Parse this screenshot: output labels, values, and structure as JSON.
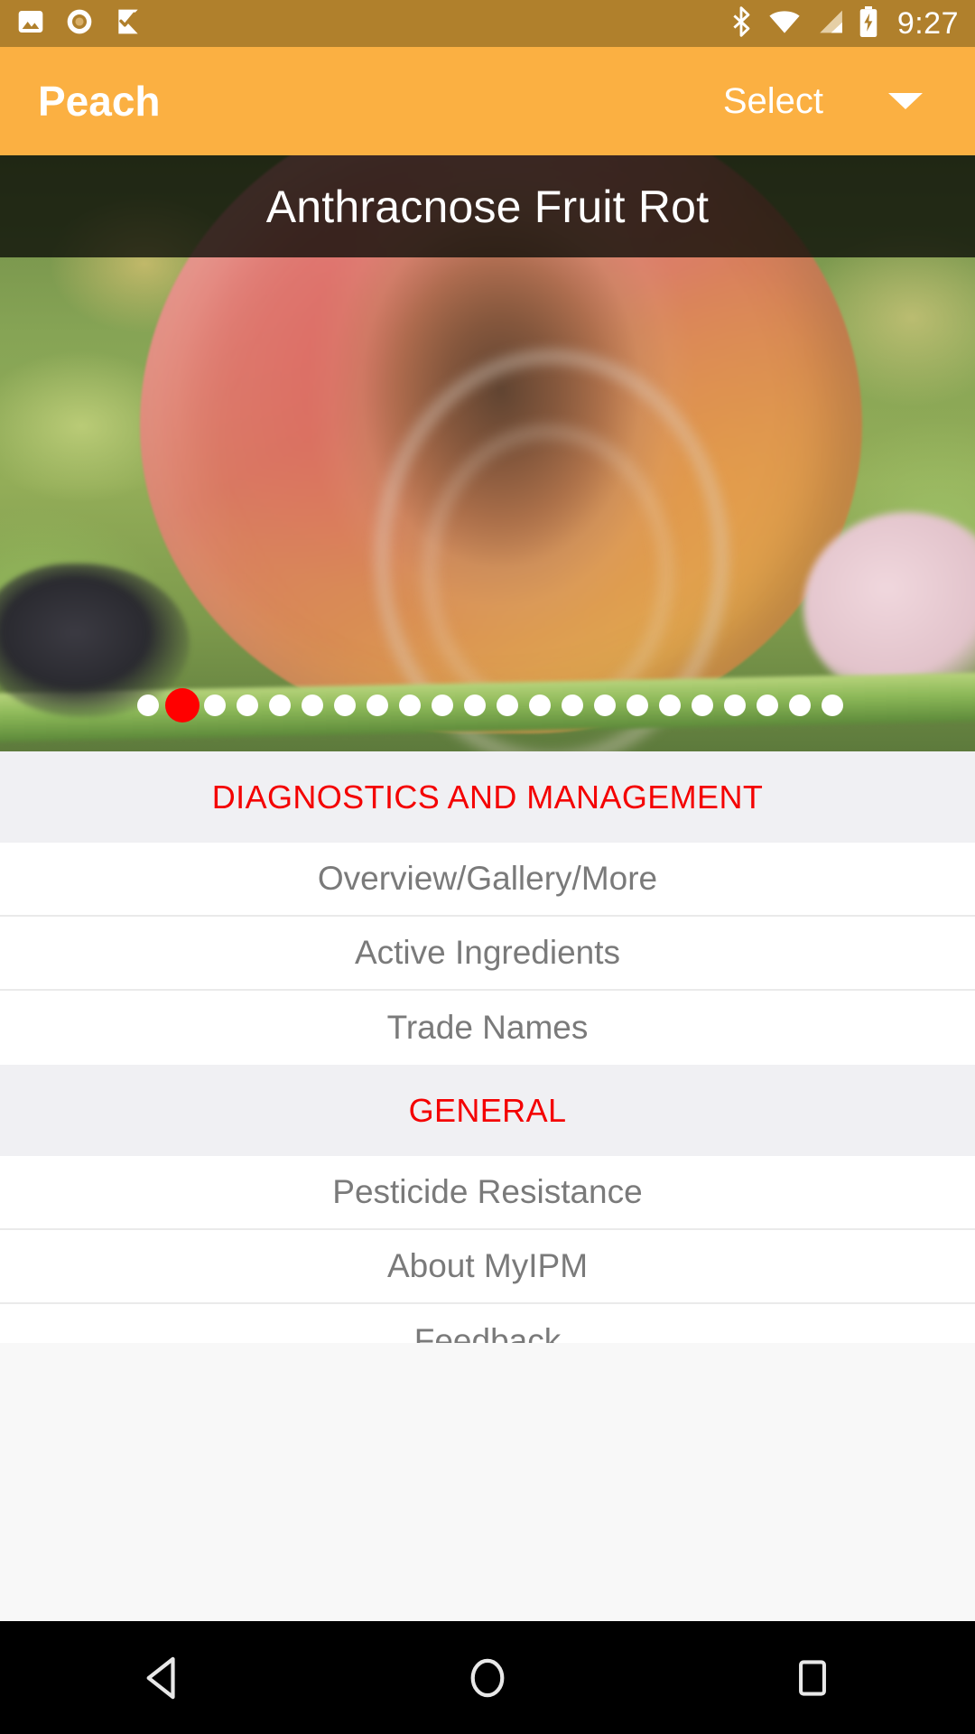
{
  "status_bar": {
    "background_color": "#b0802c",
    "clock": "9:27",
    "left_icons": [
      {
        "name": "image-icon",
        "glyph": "photo"
      },
      {
        "name": "record-disc-icon",
        "glyph": "disc"
      },
      {
        "name": "checkmark-flag-icon",
        "glyph": "flag-check"
      }
    ],
    "right_icons": [
      {
        "name": "bluetooth-icon"
      },
      {
        "name": "wifi-icon"
      },
      {
        "name": "cellular-signal-icon"
      },
      {
        "name": "battery-charging-icon"
      }
    ]
  },
  "app_bar": {
    "background_color": "#fbb042",
    "title": "Peach",
    "select_label": "Select",
    "caret": "▼"
  },
  "hero": {
    "disease_title": "Anthracnose Fruit Rot",
    "image_description": "Peach fruit with brown sunken anthracnose lesion with concentric rings",
    "carousel": {
      "total_dots": 22,
      "active_index": 1,
      "active_color": "#ff0000",
      "inactive_color": "#ffffff"
    }
  },
  "menu": {
    "sections": [
      {
        "header": "DIAGNOSTICS AND MANAGEMENT",
        "header_color": "#f40000",
        "items": [
          "Overview/Gallery/More",
          "Active Ingredients",
          "Trade Names"
        ]
      },
      {
        "header": "GENERAL",
        "header_color": "#f40000",
        "items": [
          "Pesticide Resistance",
          "About MyIPM",
          "Feedback"
        ]
      }
    ]
  },
  "nav_bar": {
    "background_color": "#000000",
    "buttons": [
      {
        "name": "back-button",
        "glyph": "triangle-left"
      },
      {
        "name": "home-button",
        "glyph": "circle"
      },
      {
        "name": "recents-button",
        "glyph": "square"
      }
    ]
  }
}
